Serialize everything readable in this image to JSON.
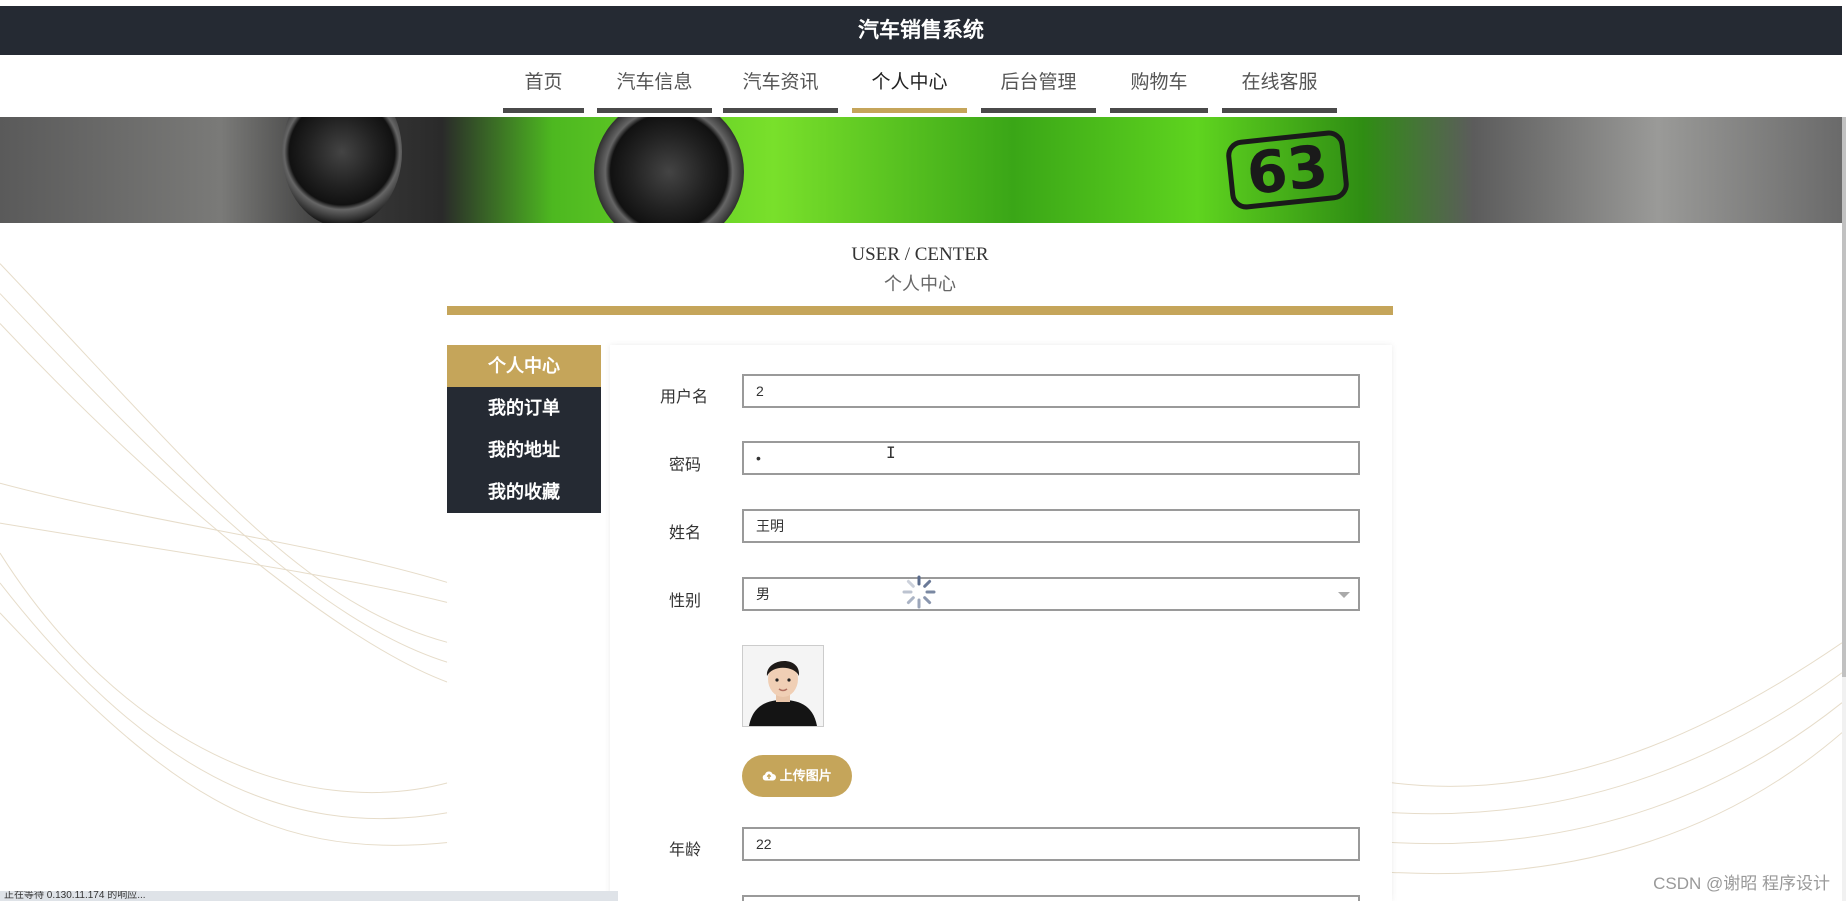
{
  "app": {
    "title": "汽车销售系统"
  },
  "nav": {
    "items": [
      {
        "label": "首页"
      },
      {
        "label": "汽车信息"
      },
      {
        "label": "汽车资讯"
      },
      {
        "label": "个人中心"
      },
      {
        "label": "后台管理"
      },
      {
        "label": "购物车"
      },
      {
        "label": "在线客服"
      }
    ],
    "active": "个人中心"
  },
  "banner": {
    "badge_number": "63"
  },
  "section": {
    "title_en": "USER / CENTER",
    "title_cn": "个人中心"
  },
  "sidebar": {
    "items": [
      {
        "label": "个人中心"
      },
      {
        "label": "我的订单"
      },
      {
        "label": "我的地址"
      },
      {
        "label": "我的收藏"
      }
    ],
    "active": "个人中心"
  },
  "form": {
    "username": {
      "label": "用户名",
      "value": "2"
    },
    "password": {
      "label": "密码",
      "value": "•"
    },
    "name": {
      "label": "姓名",
      "value": "王明"
    },
    "gender": {
      "label": "性别",
      "value": "男"
    },
    "upload_label": "上传图片",
    "age": {
      "label": "年龄",
      "value": "22"
    }
  },
  "watermark": "CSDN @谢昭  程序设计",
  "statusbar": "正在等待 0.130.11.174 的响应...",
  "colors": {
    "accent": "#c5a55a",
    "dark": "#252a33"
  },
  "icons": {
    "upload": "cloud-upload-icon",
    "select": "chevron-down-icon",
    "loading": "spinner-icon"
  }
}
